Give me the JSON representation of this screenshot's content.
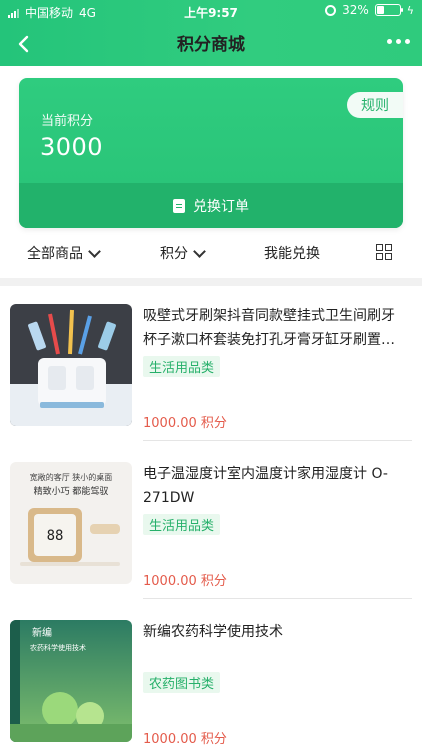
{
  "status": {
    "carrier": "中国移动",
    "network": "4G",
    "time": "上午9:57",
    "battery_percent": "32%",
    "battery_fill": 0.32
  },
  "nav": {
    "title": "积分商城"
  },
  "card": {
    "label": "当前积分",
    "points": "3000",
    "rules_label": "规则",
    "exchange_label": "兑换订单"
  },
  "filters": {
    "all_goods": "全部商品",
    "points": "积分",
    "redeemable": "我能兑换"
  },
  "products": [
    {
      "title": "吸壁式牙刷架抖音同款壁挂式卫生间刷牙杯子漱口杯套装免打孔牙膏牙缸牙刷置…",
      "category": "生活用品类",
      "price": "1000.00 积分",
      "image": "toothbrush-holder"
    },
    {
      "title": "电子温湿度计室内温度计家用湿度计 O-271DW",
      "category": "生活用品类",
      "price": "1000.00 积分",
      "image": "hygrometer",
      "image_text_1": "宽敞的客厅  狭小的桌面",
      "image_text_2": "精致小巧  都能驾驭"
    },
    {
      "title": "新编农药科学使用技术",
      "category": "农药图书类",
      "price": "1000.00 积分",
      "image": "book-cover",
      "image_text_1": "新编",
      "image_text_2": "农药科学使用技术"
    }
  ]
}
